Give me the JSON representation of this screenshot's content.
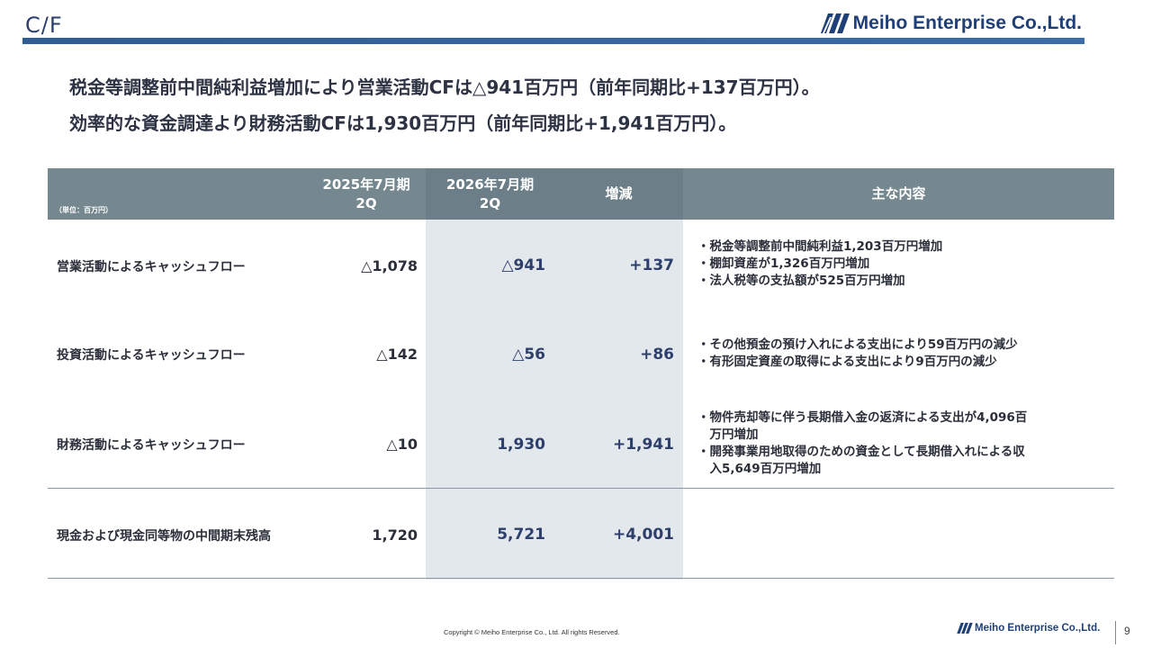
{
  "header": {
    "title": "C/F",
    "company": "Meiho Enterprise Co.,Ltd."
  },
  "headlines": [
    "税金等調整前中間純利益増加により営業活動CFは△941百万円（前年同期比+137百万円）。",
    "効率的な資金調達より財務活動CFは1,930百万円（前年同期比+1,941百万円）。"
  ],
  "table": {
    "unit": "（単位：百万円）",
    "col_prev": [
      "2025年7月期",
      "2Q"
    ],
    "col_cur": [
      "2026年7月期",
      "2Q"
    ],
    "col_diff": "増減",
    "col_notes": "主な内容",
    "rows": [
      {
        "label": "営業活動によるキャッシュフロー",
        "prev": "△1,078",
        "cur": "△941",
        "diff": "+137",
        "notes": [
          "・税金等調整前中間純利益1,203百万円増加",
          "・棚卸資産が1,326百万円増加",
          "・法人税等の支払額が525百万円増加"
        ]
      },
      {
        "label": "投資活動によるキャッシュフロー",
        "prev": "△142",
        "cur": "△56",
        "diff": "+86",
        "notes": [
          "・その他預金の預け入れによる支出により59百万円の減少",
          "・有形固定資産の取得による支出により9百万円の減少"
        ]
      },
      {
        "label": "財務活動によるキャッシュフロー",
        "prev": "△10",
        "cur": "1,930",
        "diff": "+1,941",
        "notes": [
          "・物件売却等に伴う長期借入金の返済による支出が4,096百",
          "　万円増加",
          "・開発事業用地取得のための資金として長期借入れによる収",
          "　入5,649百万円増加"
        ]
      },
      {
        "label": "現金および現金同等物の中間期末残高",
        "prev": "1,720",
        "cur": "5,721",
        "diff": "+4,001",
        "notes": []
      }
    ]
  },
  "footer": {
    "copyright": "Copyright © Meiho Enterprise Co., Ltd. All rights Reserved.",
    "company": "Meiho Enterprise Co.,Ltd.",
    "page": "9"
  },
  "colors": {
    "header_bg": "#75888f",
    "highlight_col": "#e3e8ec",
    "title_bar": "#2f5d93",
    "brand": "#1f3f78"
  }
}
